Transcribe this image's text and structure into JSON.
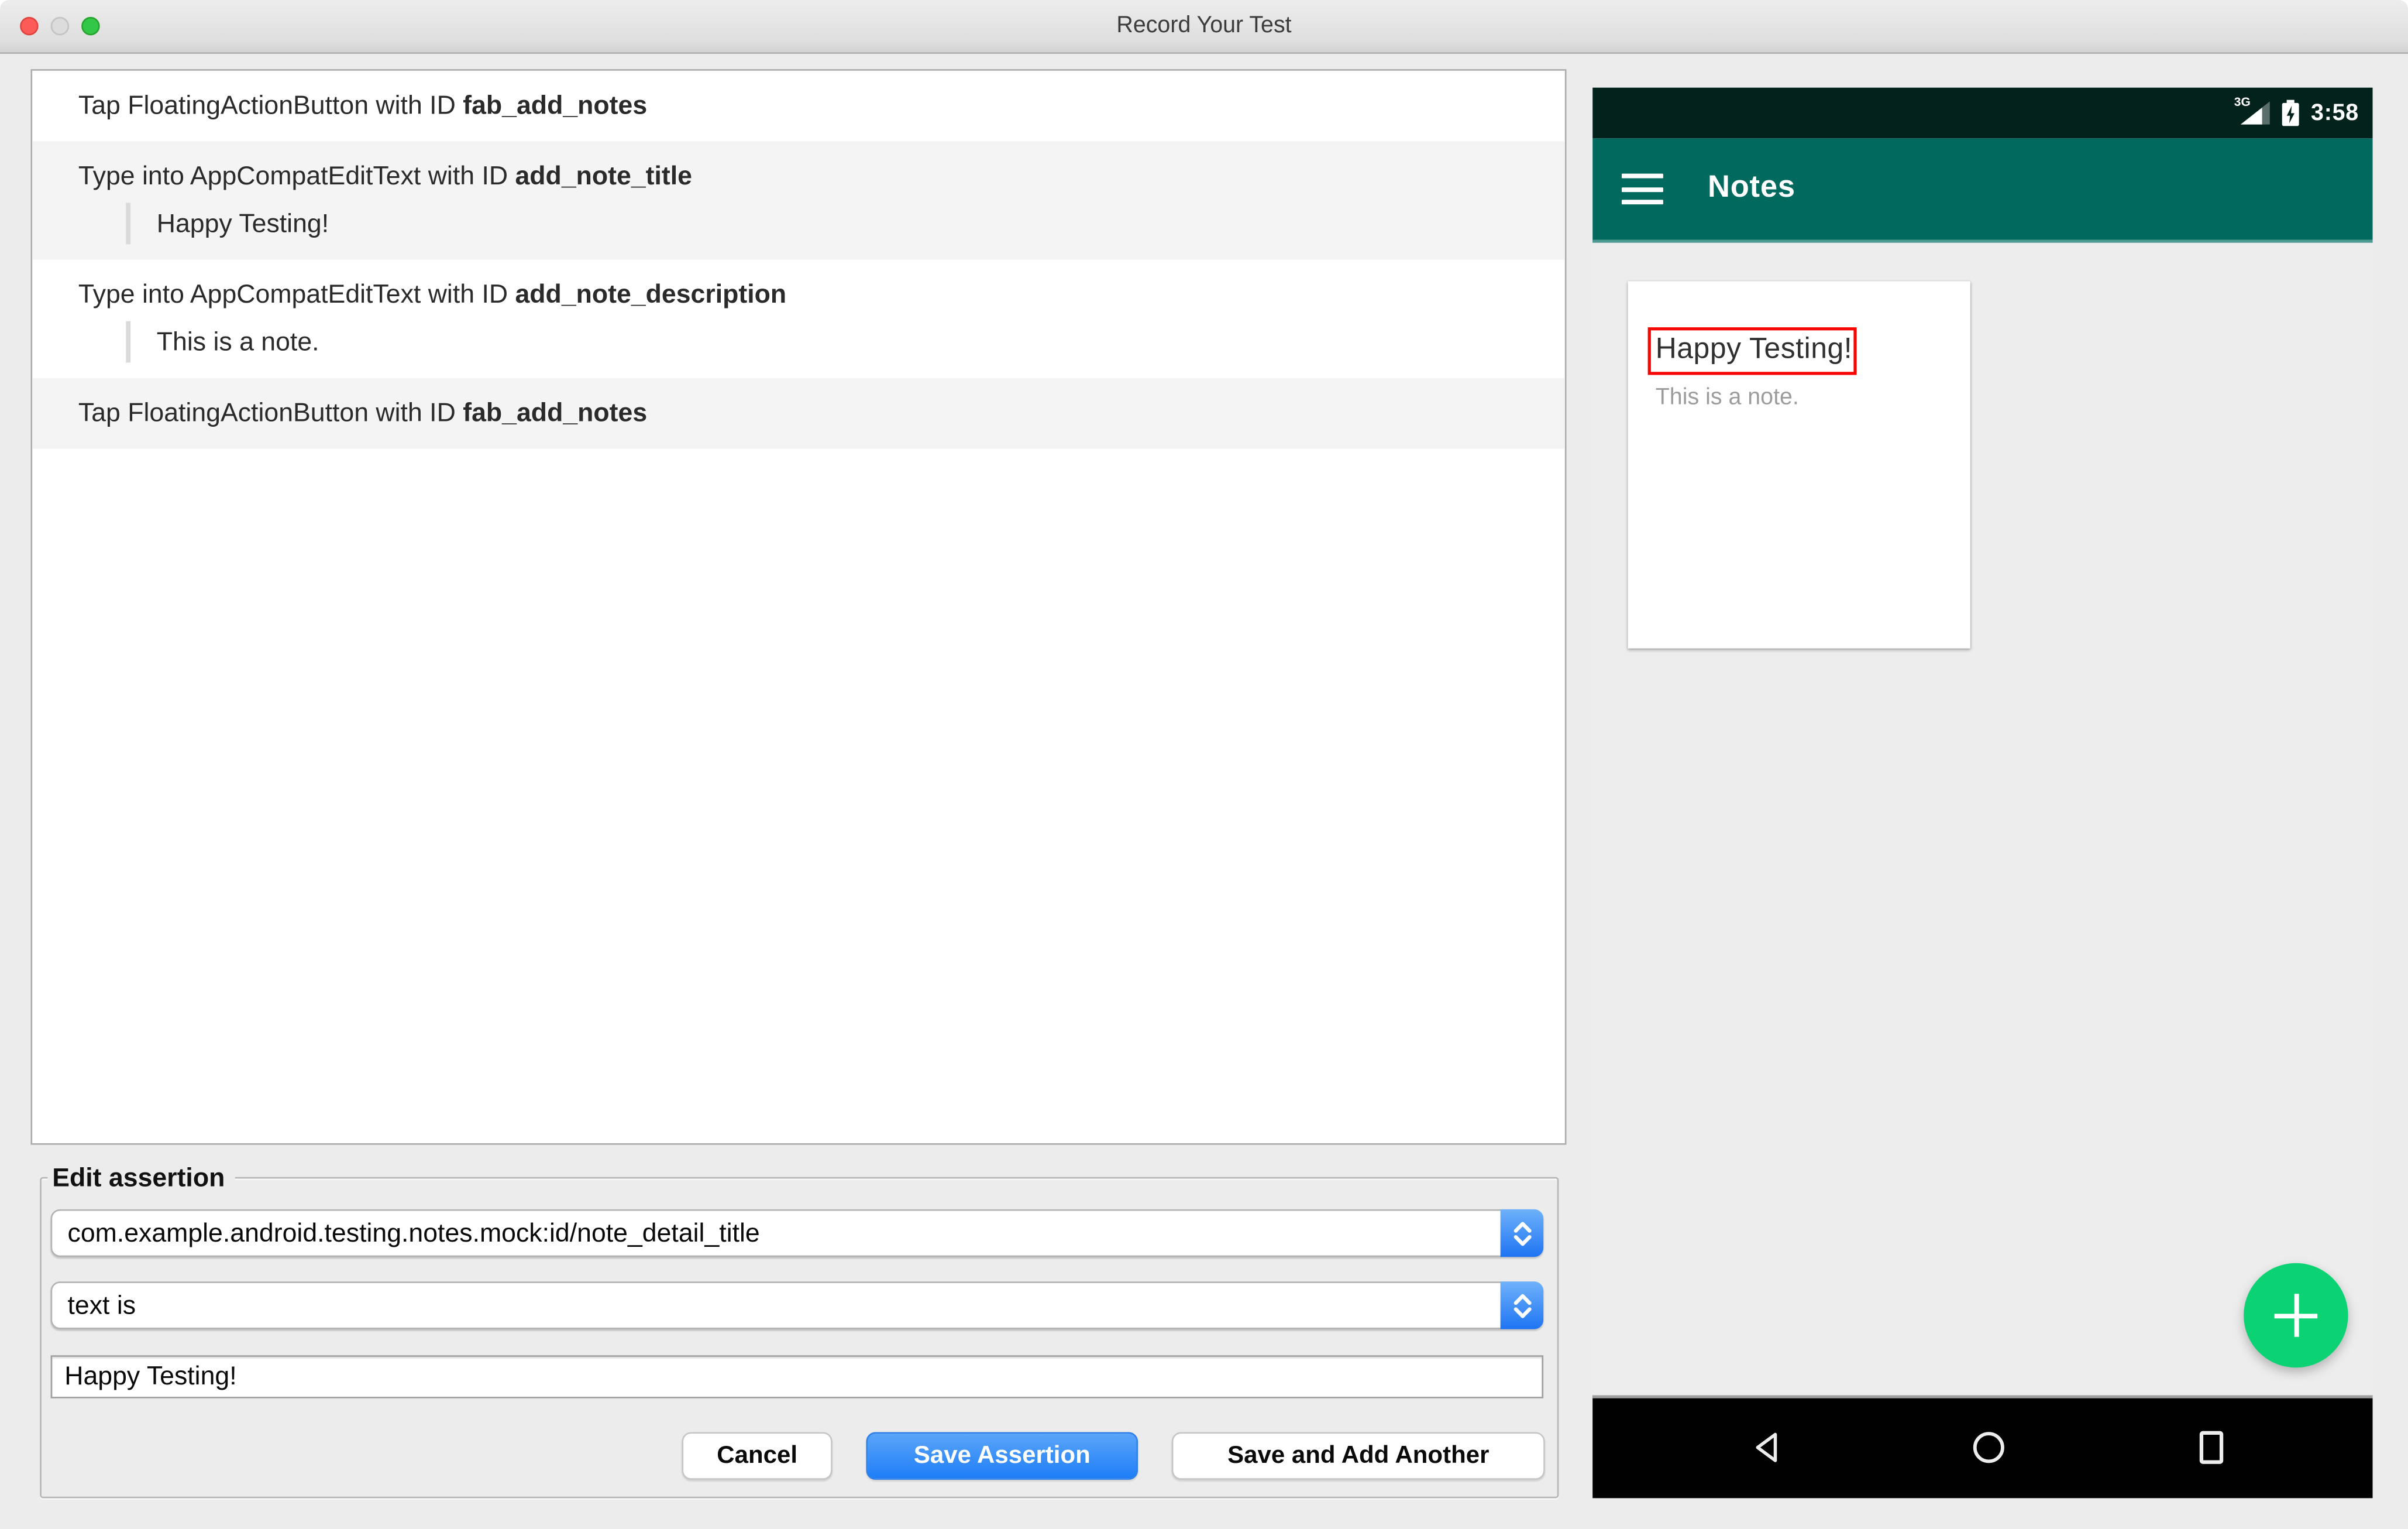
{
  "window": {
    "title": "Record Your Test"
  },
  "action_list": {
    "items": [
      {
        "prefix": "Tap FloatingActionButton with ID ",
        "id": "fab_add_notes"
      },
      {
        "prefix": "Type into AppCompatEditText with ID ",
        "id": "add_note_title",
        "value": "Happy Testing!"
      },
      {
        "prefix": "Type into AppCompatEditText with ID ",
        "id": "add_note_description",
        "value": "This is a note."
      },
      {
        "prefix": "Tap FloatingActionButton with ID ",
        "id": "fab_add_notes"
      }
    ]
  },
  "edit_assertion": {
    "legend": "Edit assertion",
    "view_matcher": {
      "value": "com.example.android.testing.notes.mock:id/note_detail_title"
    },
    "assertion_type": {
      "value": "text is"
    },
    "expected_value": "Happy Testing!",
    "buttons": {
      "cancel": "Cancel",
      "save": "Save Assertion",
      "save_and_add": "Save and Add Another"
    }
  },
  "device_preview": {
    "status_bar": {
      "network": "3G",
      "time": "3:58"
    },
    "app_bar": {
      "title": "Notes"
    },
    "note_card": {
      "title": "Happy Testing!",
      "description": "This is a note."
    }
  },
  "icons": {
    "window_controls": [
      "close",
      "minimize",
      "zoom"
    ],
    "combo_stepper": "up-down-chevrons",
    "status_bar": [
      "cellular-signal-3g",
      "battery-charging"
    ],
    "app_bar": "hamburger-menu",
    "fab": "plus",
    "nav_bar": [
      "back-triangle",
      "home-circle",
      "recents-square"
    ]
  },
  "colors": {
    "window_background": "#ECECEC",
    "app_bar_teal": "#02695E",
    "status_bar_teal": "#03221C",
    "fab_green": "#0BD273",
    "assertion_highlight_red": "#F70600",
    "primary_button_blue": "#1F7EF7",
    "row_stripe": "#F4F4F4"
  }
}
